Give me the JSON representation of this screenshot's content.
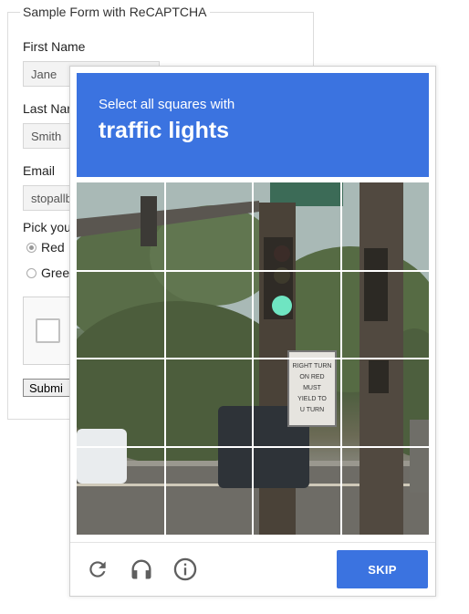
{
  "form": {
    "legend": "Sample Form with ReCAPTCHA",
    "first_name_label": "First Name",
    "first_name_value": "Jane",
    "last_name_label": "Last Nar",
    "last_name_value": "Smith",
    "email_label": "Email",
    "email_value": "stopallb",
    "pick_label": "Pick you",
    "options": [
      {
        "label": "Red",
        "checked": true
      },
      {
        "label": "Greer",
        "checked": false
      }
    ],
    "submit_label": "Submi"
  },
  "challenge": {
    "instruction_line": "Select all squares with",
    "target_object": "traffic lights",
    "sign_text": [
      "RIGHT TURN",
      "ON RED",
      "MUST",
      "YIELD TO",
      "U TURN"
    ],
    "grid_rows": 4,
    "grid_cols": 4,
    "footer": {
      "icons": [
        "reload-icon",
        "headphones-icon",
        "info-icon"
      ],
      "skip_label": "SKIP"
    },
    "accent_color": "#3b73e0"
  }
}
